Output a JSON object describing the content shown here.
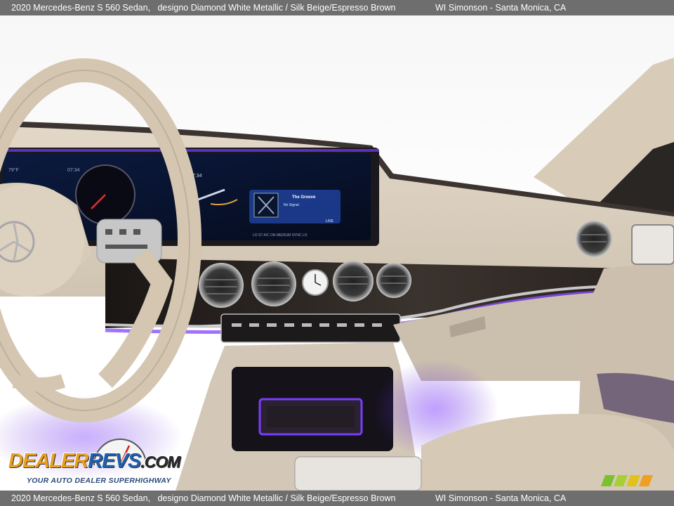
{
  "header": {
    "vehicle": "2020 Mercedes-Benz S 560 Sedan,",
    "colors": "designo Diamond White Metallic / Silk Beige/Espresso Brown",
    "dealer": "WI Simonson - Santa Monica, CA"
  },
  "footer": {
    "vehicle": "2020 Mercedes-Benz S 560 Sedan,",
    "colors": "designo Diamond White Metallic / Silk Beige/Espresso Brown",
    "dealer": "WI Simonson - Santa Monica, CA"
  },
  "photo": {
    "subject": "Mercedes-Benz S-Class dashboard interior",
    "colors": {
      "leather": "#d9cdbd",
      "ambient": "#7a3cff",
      "trim": "#2a2522",
      "screen": "#0b1430"
    }
  },
  "display": {
    "time_left": "07:34",
    "time_right": "07:34",
    "temp": "79°F",
    "media_title": "The Groove",
    "media_status": "No Signal",
    "media_badge": "LIVE",
    "climate_strip": "LO   S7   A/C ON   MEDIUM   SYNC   LO"
  },
  "watermark": {
    "brand_part1": "DEALER",
    "brand_part2": "REVS",
    "brand_part3": ".COM",
    "tagline": "YOUR AUTO DEALER SUPERHIGHWAY",
    "dial": "4 5 6"
  }
}
